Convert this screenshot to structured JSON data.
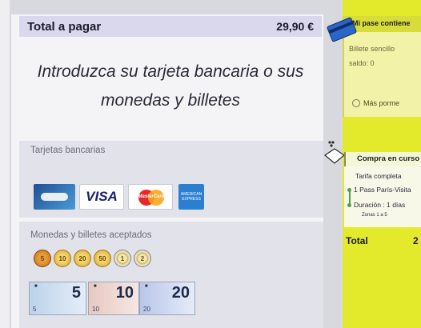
{
  "payment": {
    "total_label": "Total a pagar",
    "total_amount": "29,90 €",
    "instruction": "Introduzca su tarjeta bancaria o sus monedas y billetes"
  },
  "cards_panel": {
    "title": "Tarjetas bancarias",
    "cards": [
      {
        "name": "CB",
        "icon": "cb-card-icon"
      },
      {
        "name": "VISA",
        "icon": "visa-card-icon"
      },
      {
        "name": "MasterCard",
        "icon": "mastercard-icon"
      },
      {
        "name": "AMERICAN EXPRESS",
        "icon": "amex-card-icon"
      }
    ],
    "visa_label": "VISA",
    "mastercard_label": "MasterCard",
    "amex_label": "AMERICAN EXPRESS"
  },
  "coins_panel": {
    "title": "Monedas y billetes aceptados",
    "coins": [
      "5",
      "10",
      "20",
      "50",
      "1",
      "2"
    ],
    "notes": [
      "5",
      "10",
      "20"
    ]
  },
  "sidebar": {
    "pase_title": "Mi pase contiene",
    "billete": "Billete sencillo",
    "saldo": "saldo: 0",
    "mas_button": "Más porme",
    "compra_title": "Compra en curso",
    "tarifa": "Tarifa completa",
    "pass_item": "1 Pass París-Visita",
    "duracion": "Duración : 1 días",
    "zonas": "Zonas 1 a 5",
    "total_label": "Total",
    "total_amount": "2"
  },
  "colors": {
    "total_bar": "#d9d8ec",
    "sidebar_yellow": "#e3ea2c",
    "panel_bg": "#e2e2ea"
  }
}
